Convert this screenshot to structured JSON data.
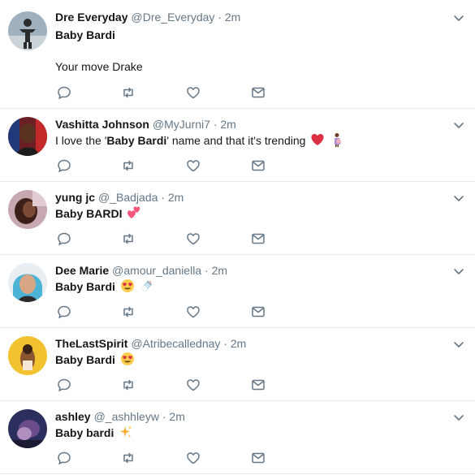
{
  "tweets": [
    {
      "name": "Dre Everyday",
      "handle": "@Dre_Everyday",
      "dot": "·",
      "time": "2m",
      "line1": "Baby Bardi",
      "line2": "Your move Drake",
      "avatar": "person-silhouette-avatar"
    },
    {
      "name": "Vashitta Johnson",
      "handle": "@MyJurni7",
      "dot": "·",
      "time": "2m",
      "text_before": "I love the '",
      "text_bold": "Baby Bardi",
      "text_after": "' name and that it's trending",
      "emojis": [
        "red-heart-emoji",
        "pregnant-woman-emoji"
      ],
      "avatar": "woman-avatar"
    },
    {
      "name": "yung jc",
      "handle": "@_Badjada",
      "dot": "·",
      "time": "2m",
      "text": "Baby BARDI",
      "emojis": [
        "two-hearts-emoji"
      ],
      "avatar": "selfie-avatar"
    },
    {
      "name": "Dee Marie",
      "handle": "@amour_daniella",
      "dot": "·",
      "time": "2m",
      "text": "Baby Bardi",
      "emojis": [
        "heart-eyes-emoji",
        "baby-bottle-emoji"
      ],
      "avatar": "blue-hair-avatar"
    },
    {
      "name": "TheLastSpirit",
      "handle": "@Atribecallednay",
      "dot": "·",
      "time": "2m",
      "text": "Baby Bardi",
      "emojis": [
        "heart-eyes-emoji"
      ],
      "avatar": "yellow-bg-avatar"
    },
    {
      "name": "ashley",
      "handle": "@_ashhleyw",
      "dot": "·",
      "time": "2m",
      "text": "Baby bardi",
      "emojis": [
        "sparkles-emoji"
      ],
      "avatar": "dark-avatar"
    }
  ],
  "colors": {
    "text": "#14171a",
    "muted": "#657786",
    "divider": "#e6ecf0"
  }
}
